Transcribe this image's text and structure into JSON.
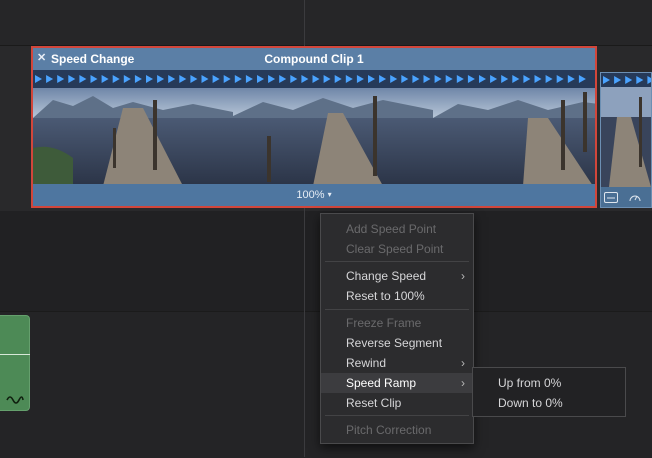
{
  "clip": {
    "close_glyph": "✕",
    "speed_title": "Speed Change",
    "name": "Compound Clip 1",
    "speed_value": "100%",
    "speed_caret": "▾"
  },
  "second_clip": {
    "icons": [
      "filmstrip-icon",
      "speedometer-icon"
    ]
  },
  "audio_clip": {
    "icon": "waveform-curve-icon"
  },
  "context_menu": {
    "items": [
      {
        "label": "Add Speed Point",
        "state": "disabled"
      },
      {
        "label": "Clear Speed Point",
        "state": "disabled"
      },
      {
        "label": "Change Speed",
        "state": "enabled",
        "submenu": true
      },
      {
        "label": "Reset to 100%",
        "state": "enabled"
      },
      {
        "label": "Freeze Frame",
        "state": "disabled"
      },
      {
        "label": "Reverse Segment",
        "state": "enabled"
      },
      {
        "label": "Rewind",
        "state": "enabled",
        "submenu": true
      },
      {
        "label": "Speed Ramp",
        "state": "active",
        "submenu": true
      },
      {
        "label": "Reset Clip",
        "state": "enabled"
      },
      {
        "label": "Pitch Correction",
        "state": "disabled"
      }
    ],
    "submenu_arrow": "›"
  },
  "speed_ramp_submenu": {
    "items": [
      {
        "label": "Up from 0%"
      },
      {
        "label": "Down to 0%"
      }
    ]
  },
  "colors": {
    "clip_selected_border": "#d2463b",
    "clip_header": "#5b7fa6",
    "speed_arrow": "#4aa3ff",
    "audio_clip": "#4d8a56"
  }
}
